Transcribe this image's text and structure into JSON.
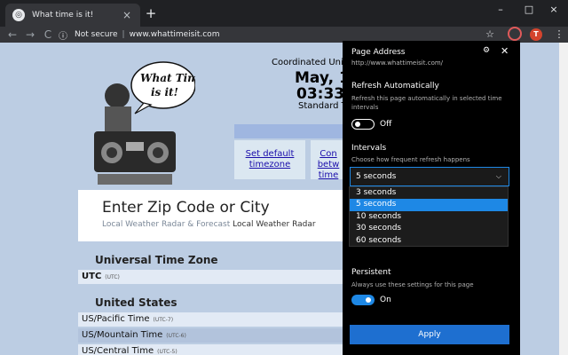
{
  "browser": {
    "tab_title": "What time is it!",
    "tab_close": "×",
    "new_tab": "+",
    "window_controls": {
      "minimize": "–",
      "maximize": "□",
      "close": "×"
    },
    "nav": {
      "back": "←",
      "forward": "→",
      "reload": "C"
    },
    "omnibox": {
      "info": "ⓘ",
      "security": "Not secure",
      "separator": "|",
      "url": "www.whattimeisit.com"
    },
    "bookmark_star": "☆",
    "profile_initial": "T",
    "menu": "⋮"
  },
  "page": {
    "logo_text_1": "What Time",
    "logo_text_2": "is it!",
    "clock_label": "Coordinated Uni",
    "date_partial": "May, 1",
    "time_partial": "03:33",
    "standard_label": "Standard T",
    "links": {
      "set_default": "Set default timezone",
      "convert": "Con betw time"
    },
    "zip": {
      "title": "Enter Zip Code or City",
      "subtitle": "Local Weather Radar & Forecast",
      "subtitle_bold": "Local Weather Radar"
    },
    "sections": [
      {
        "title": "Universal Time Zone",
        "rows": [
          {
            "name": "UTC",
            "abbr": "(UTC)"
          }
        ]
      },
      {
        "title": "United States",
        "rows": [
          {
            "name": "US/Pacific Time",
            "abbr": "(UTC-7)"
          },
          {
            "name": "US/Mountain Time",
            "abbr": "(UTC-6)"
          },
          {
            "name": "US/Central Time",
            "abbr": "(UTC-5)"
          }
        ]
      }
    ]
  },
  "popup": {
    "header": "Page Address",
    "url": "http://www.whattimeisit.com/",
    "settings_icon": "⚙",
    "close_icon": "✕",
    "refresh": {
      "title": "Refresh Automatically",
      "desc": "Refresh this page automatically in selected time intervals",
      "state": "Off"
    },
    "intervals": {
      "title": "Intervals",
      "desc": "Choose how frequent refresh happens",
      "selected": "5 seconds",
      "chevron": "⌵",
      "options": [
        "3 seconds",
        "5 seconds",
        "10 seconds",
        "30 seconds",
        "60 seconds"
      ]
    },
    "persistent": {
      "title": "Persistent",
      "desc": "Always use these settings for this page",
      "state": "On"
    },
    "apply": "Apply"
  },
  "colors": {
    "accent": "#1e88e5",
    "page_bg": "#bccde3",
    "popup_bg": "#000000"
  }
}
